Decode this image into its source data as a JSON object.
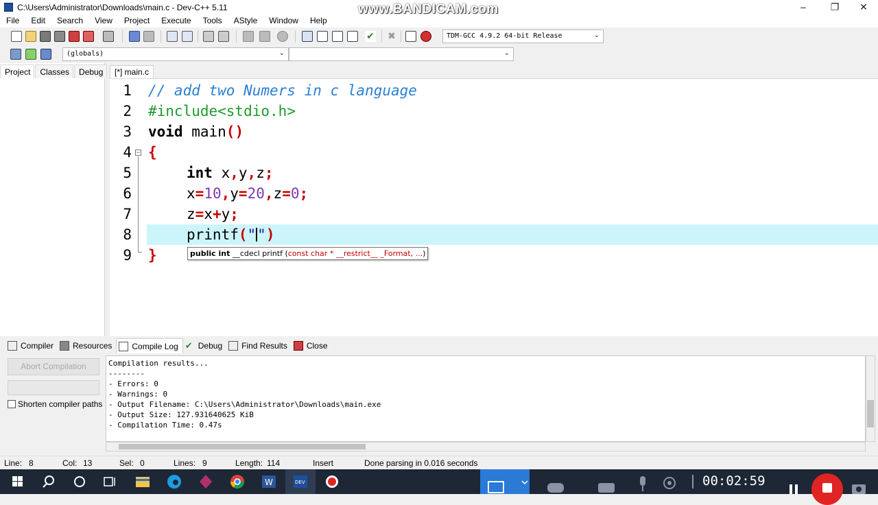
{
  "window": {
    "title": "C:\\Users\\Administrator\\Downloads\\main.c - Dev-C++ 5.11",
    "watermark": "www.BANDICAM.com",
    "minimize": "–",
    "restore": "❐",
    "close": "✕"
  },
  "menu": [
    "File",
    "Edit",
    "Search",
    "View",
    "Project",
    "Execute",
    "Tools",
    "AStyle",
    "Window",
    "Help"
  ],
  "toolbar": {
    "compiler_combo": "TDM-GCC 4.9.2 64-bit Release",
    "scope_combo": "(globals)",
    "member_combo": ""
  },
  "left_tabs": [
    "Project",
    "Classes",
    "Debug"
  ],
  "editor": {
    "tab": "[*] main.c",
    "lines": [
      "1",
      "2",
      "3",
      "4",
      "5",
      "6",
      "7",
      "8",
      "9"
    ],
    "code": {
      "l1": "// add two Numers in c language",
      "l2": "#include<stdio.h>",
      "l3_kw": "void",
      "l3_name": " main",
      "l3_parens": "()",
      "l4": "{",
      "l5_kw": "int",
      "l5_a": " x",
      "l5_c1": ",",
      "l5_b": "y",
      "l5_c2": ",",
      "l5_c": "z",
      "l5_semi": ";",
      "l6_x": "x",
      "l6_eq1": "=",
      "l6_10": "10",
      "l6_c1": ",",
      "l6_y": "y",
      "l6_eq2": "=",
      "l6_20": "20",
      "l6_c2": ",",
      "l6_z": "z",
      "l6_eq3": "=",
      "l6_0": "0",
      "l6_semi": ";",
      "l7_z": "z",
      "l7_eq": "=",
      "l7_x": "x",
      "l7_plus": "+",
      "l7_y": "y",
      "l7_semi": ";",
      "l8_fn": "printf",
      "l8_open": "(",
      "l8_q1": "\"",
      "l8_q2": "\"",
      "l8_close": ")",
      "l9": "}"
    },
    "hint": {
      "bold": "public int",
      "mid": " __cdecl printf (",
      "params": "const char * __restrict__ _Format, ...",
      "end": ")"
    }
  },
  "bottom_tabs": [
    "Compiler",
    "Resources",
    "Compile Log",
    "Debug",
    "Find Results",
    "Close"
  ],
  "compile": {
    "abort_label": "Abort Compilation",
    "shorten_label": "Shorten compiler paths",
    "log": [
      "Compilation results...",
      "--------",
      "- Errors: 0",
      "- Warnings: 0",
      "- Output Filename: C:\\Users\\Administrator\\Downloads\\main.exe",
      "- Output Size: 127.931640625 KiB",
      "- Compilation Time: 0.47s"
    ]
  },
  "status": {
    "line_label": "Line:",
    "line": "8",
    "col_label": "Col:",
    "col": "13",
    "sel_label": "Sel:",
    "sel": "0",
    "lines_label": "Lines:",
    "lines": "9",
    "length_label": "Length:",
    "length": "114",
    "mode": "Insert",
    "message": "Done parsing in 0.016 seconds"
  },
  "taskbar": {
    "clock": "00:02:59"
  },
  "colors": {
    "comment": "#2a7fd4",
    "preprocessor": "#1e9a2b",
    "symbol": "#c80000",
    "number": "#7c3ab0",
    "current_line": "#ccf5fb"
  }
}
